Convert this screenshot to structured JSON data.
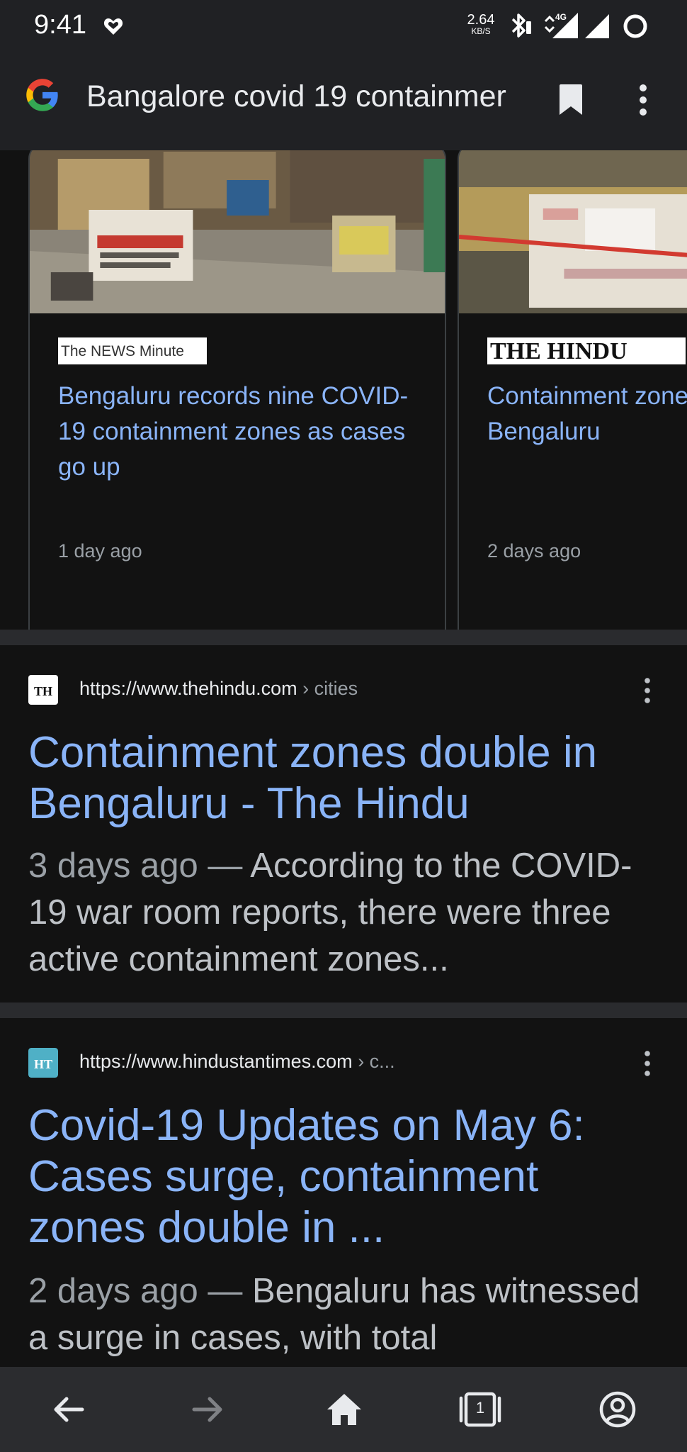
{
  "status_bar": {
    "time": "9:41",
    "net_speed_value": "2.64",
    "net_speed_unit": "KB/S",
    "network_label": "4G",
    "icons": [
      "heart-icon",
      "bluetooth-icon",
      "signal-4g-icon",
      "signal-icon",
      "battery-icon"
    ]
  },
  "toolbar": {
    "query": "Bangalore covid 19 containmer",
    "icons": [
      "google-logo-icon",
      "bookmark-icon",
      "more-vert-icon"
    ]
  },
  "news_cards": [
    {
      "source": "The NEWS Minute",
      "title": "Bengaluru records nine COVID-19 containment zones as cases go up",
      "time": "1 day ago"
    },
    {
      "source": "THE HINDU",
      "title": "Containment zones in Bengaluru",
      "time": "2 days ago"
    }
  ],
  "results": [
    {
      "favicon": "TH",
      "url": "https://www.thehindu.com",
      "breadcrumb": "› cities",
      "title": "Containment zones double in Bengaluru - The Hindu",
      "date": "3 days ago",
      "separator": " — ",
      "snippet": "According to the COVID-19 war room reports, there were three active containment zones..."
    },
    {
      "favicon": "HT",
      "url": "https://www.hindustantimes.com",
      "breadcrumb": "› c...",
      "title": "Covid-19 Updates on May 6: Cases surge, containment zones double in ...",
      "date": "2 days ago",
      "separator": " — ",
      "snippet": "Bengaluru has witnessed a surge in cases, with total"
    }
  ],
  "bottom_nav": {
    "tab_count": "1",
    "icons": [
      "back-icon",
      "forward-icon",
      "home-icon",
      "tab-switcher-icon",
      "account-icon"
    ]
  },
  "colors": {
    "background": "#121212",
    "toolbar": "#202124",
    "link": "#8ab4f8",
    "muted": "#9aa0a6",
    "nav": "#2b2c2f"
  }
}
